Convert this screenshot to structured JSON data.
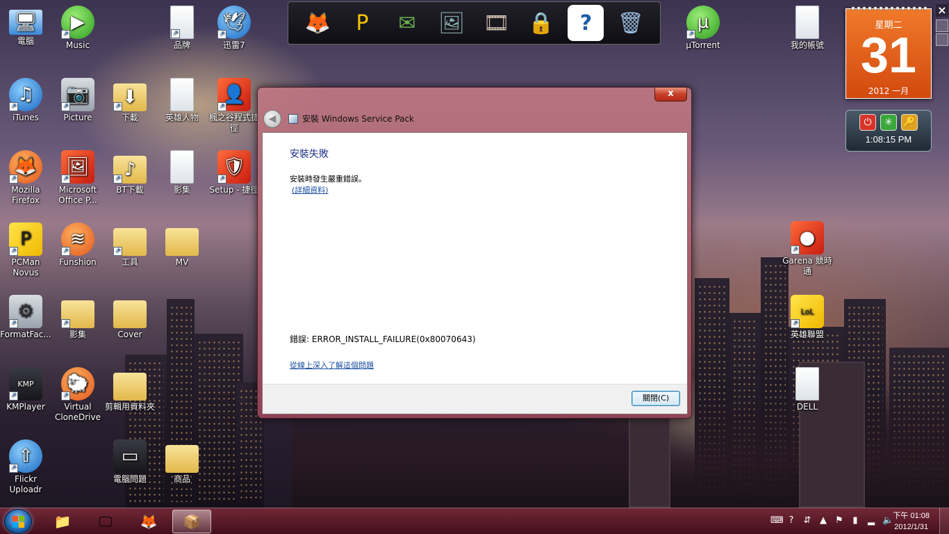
{
  "desktop_icons": [
    {
      "label": "電腦",
      "icon": "computer-icon",
      "glyph": "🖥",
      "style": "i-pc",
      "shortcut": false
    },
    {
      "label": "Music",
      "icon": "music-play-icon",
      "glyph": "▶",
      "style": "i-green",
      "shortcut": true
    },
    {
      "label": "品牌",
      "icon": "document-icon",
      "glyph": "",
      "style": "i-doc",
      "shortcut": true
    },
    {
      "label": "迅雷7",
      "icon": "thunder-bird-icon",
      "glyph": "🕊",
      "style": "i-blue",
      "shortcut": true
    },
    {
      "label": "iTunes",
      "icon": "itunes-icon",
      "glyph": "♫",
      "style": "i-blue",
      "shortcut": true
    },
    {
      "label": "Picture",
      "icon": "camera-icon",
      "glyph": "📷",
      "style": "i-gray",
      "shortcut": true
    },
    {
      "label": "下載",
      "icon": "folder-download-icon",
      "glyph": "⬇",
      "style": "i-folder",
      "shortcut": true
    },
    {
      "label": "英雄人物",
      "icon": "document-icon",
      "glyph": "",
      "style": "i-doc",
      "shortcut": false
    },
    {
      "label": "楓之谷程式捷徑",
      "icon": "game-character-icon",
      "glyph": "👤",
      "style": "i-red",
      "shortcut": true
    },
    {
      "label": "Mozilla Firefox",
      "icon": "firefox-icon",
      "glyph": "🦊",
      "style": "i-orange",
      "shortcut": true
    },
    {
      "label": "Microsoft Office P...",
      "icon": "office-picture-icon",
      "glyph": "🖼",
      "style": "i-red",
      "shortcut": true
    },
    {
      "label": "BT下載",
      "icon": "folder-music-icon",
      "glyph": "♪",
      "style": "i-folder",
      "shortcut": true
    },
    {
      "label": "影集",
      "icon": "document-icon",
      "glyph": "",
      "style": "i-doc",
      "shortcut": false
    },
    {
      "label": "Setup - 捷徑",
      "icon": "setup-icon",
      "glyph": "🛡",
      "style": "i-red",
      "shortcut": true
    },
    {
      "label": "PCMan Novus",
      "icon": "pcman-icon",
      "glyph": "P",
      "style": "i-yellow",
      "shortcut": true
    },
    {
      "label": "Funshion",
      "icon": "funshion-icon",
      "glyph": "≋",
      "style": "i-orange",
      "shortcut": true
    },
    {
      "label": "工具",
      "icon": "folder-icon",
      "glyph": "",
      "style": "i-folder",
      "shortcut": true
    },
    {
      "label": "MV",
      "icon": "folder-icon",
      "glyph": "",
      "style": "i-folder",
      "shortcut": false
    },
    {
      "label": "FormatFac...",
      "icon": "format-factory-icon",
      "glyph": "⚙",
      "style": "i-gray",
      "shortcut": true
    },
    {
      "label": "影集",
      "icon": "folder-icon",
      "glyph": "",
      "style": "i-folder",
      "shortcut": true
    },
    {
      "label": "Cover",
      "icon": "folder-icon",
      "glyph": "",
      "style": "i-folder",
      "shortcut": false
    },
    {
      "label": "KMPlayer",
      "icon": "kmplayer-icon",
      "glyph": "KMP",
      "style": "i-dark",
      "shortcut": true
    },
    {
      "label": "Virtual CloneDrive",
      "icon": "clone-drive-sheep-icon",
      "glyph": "🐑",
      "style": "i-orange",
      "shortcut": true
    },
    {
      "label": "剪輯用資料夾",
      "icon": "folder-icon",
      "glyph": "",
      "style": "i-folder",
      "shortcut": false
    },
    {
      "label": "Flickr Uploadr",
      "icon": "flickr-uploadr-icon",
      "glyph": "⇧",
      "style": "i-blue",
      "shortcut": true
    },
    {
      "label": "電腦問題",
      "icon": "film-strip-icon",
      "glyph": "▭",
      "style": "i-dark",
      "shortcut": false
    },
    {
      "label": "商品",
      "icon": "folder-icon",
      "glyph": "",
      "style": "i-folder",
      "shortcut": false
    },
    {
      "label": "µTorrent",
      "icon": "utorrent-icon",
      "glyph": "µ",
      "style": "i-green",
      "shortcut": true
    },
    {
      "label": "我的帳號",
      "icon": "document-icon",
      "glyph": "",
      "style": "i-doc",
      "shortcut": false
    },
    {
      "label": "Garena 競時通",
      "icon": "garena-icon",
      "glyph": "●",
      "style": "i-red",
      "shortcut": true
    },
    {
      "label": "英雄聯盟",
      "icon": "league-of-legends-icon",
      "glyph": "LoL",
      "style": "i-yellow",
      "shortcut": true
    },
    {
      "label": "DELL",
      "icon": "document-icon",
      "glyph": "",
      "style": "i-doc",
      "shortcut": false
    }
  ],
  "dock_items": [
    {
      "name": "dock-firefox",
      "icon": "firefox-icon",
      "glyph": "🦊",
      "color": "#f07a1a"
    },
    {
      "name": "dock-pcman",
      "icon": "pcman-icon",
      "glyph": "P",
      "color": "#f5c400"
    },
    {
      "name": "dock-mail",
      "icon": "mail-icon",
      "glyph": "✉",
      "color": "#6ab04c"
    },
    {
      "name": "dock-photos",
      "icon": "photos-icon",
      "glyph": "🖼",
      "color": "#8aa"
    },
    {
      "name": "dock-film",
      "icon": "film-reel-icon",
      "glyph": "🎞",
      "color": "#cba"
    },
    {
      "name": "dock-lock",
      "icon": "padlock-icon",
      "glyph": "🔒",
      "color": "#c90"
    },
    {
      "name": "dock-help",
      "icon": "help-icon",
      "glyph": "?",
      "color": "#ddd"
    },
    {
      "name": "dock-recycle",
      "icon": "recycle-bin-icon",
      "glyph": "🗑",
      "color": "#9bd"
    }
  ],
  "calendar": {
    "weekday": "星期二",
    "day": "31",
    "year_month": "2012 一月"
  },
  "clock_gadget": {
    "time": "1:08:15 PM"
  },
  "dialog": {
    "title": "安裝 Windows Service Pack",
    "heading": "安裝失敗",
    "message": "安裝時發生嚴重錯誤。",
    "details_link": "(詳細資料)",
    "error": "錯誤: ERROR_INSTALL_FAILURE(0x80070643)",
    "online_link": "從線上深入了解這個問題",
    "close_button": "關閉(C)",
    "close_x": "x"
  },
  "taskbar": {
    "pinned": [
      {
        "name": "taskbar-explorer",
        "icon": "folder-explorer-icon",
        "glyph": "📁"
      },
      {
        "name": "taskbar-kmplayer",
        "icon": "kmplayer-icon",
        "glyph": "🖵"
      },
      {
        "name": "taskbar-firefox",
        "icon": "firefox-icon",
        "glyph": "🦊"
      },
      {
        "name": "taskbar-installer",
        "icon": "installer-icon",
        "glyph": "📦",
        "active": true
      }
    ],
    "tray_icons": [
      "keyboard-icon",
      "help-tray-icon",
      "arrow-tray-icon",
      "show-hidden-icons",
      "flag-icon",
      "power-icon",
      "network-icon",
      "volume-icon"
    ],
    "clock_line1": "下午 01:08",
    "clock_line2": "2012/1/31"
  }
}
